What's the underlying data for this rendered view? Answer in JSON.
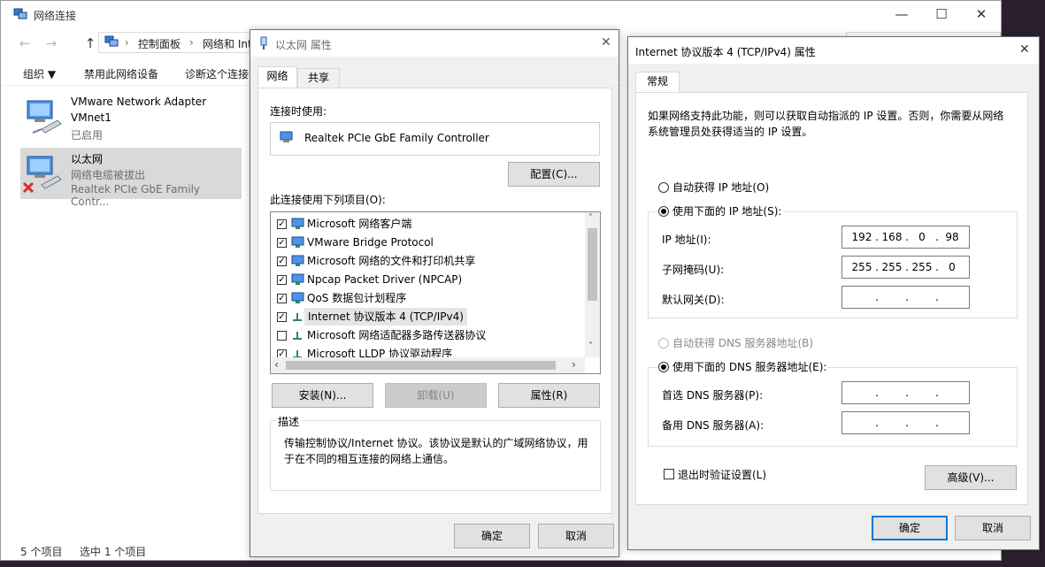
{
  "explorer": {
    "title": "网络连接",
    "nav": {
      "back": "←",
      "forward": "→",
      "up": "↑"
    },
    "breadcrumb": [
      "控制面板",
      "网络和 Int"
    ],
    "commands": [
      "组织 ▼",
      "禁用此网络设备",
      "诊断这个连接"
    ],
    "items": [
      {
        "name": "VMware Network Adapter",
        "line2": "VMnet1",
        "line3": "已启用"
      },
      {
        "name": "以太网",
        "line2": "网络电缆被拔出",
        "line3": "Realtek PCIe GbE Family Contr..."
      }
    ],
    "status": {
      "count": "5 个项目",
      "selected": "选中 1 个项目"
    },
    "window_buttons": {
      "minimize": "—",
      "maximize": "☐",
      "close": "✕"
    }
  },
  "eth_dialog": {
    "title": "以太网 属性",
    "close": "✕",
    "tabs": [
      "网络",
      "共享"
    ],
    "connect_using_label": "连接时使用:",
    "adapter": "Realtek PCIe GbE Family Controller",
    "configure_button": "配置(C)...",
    "items_label": "此连接使用下列项目(O):",
    "items": [
      {
        "label": "Microsoft 网络客户端",
        "checked": true
      },
      {
        "label": "VMware Bridge Protocol",
        "checked": true
      },
      {
        "label": "Microsoft 网络的文件和打印机共享",
        "checked": true
      },
      {
        "label": "Npcap Packet Driver (NPCAP)",
        "checked": true
      },
      {
        "label": "QoS 数据包计划程序",
        "checked": true
      },
      {
        "label": "Internet 协议版本 4 (TCP/IPv4)",
        "checked": true
      },
      {
        "label": "Microsoft 网络适配器多路传送器协议",
        "checked": false
      },
      {
        "label": "Microsoft LLDP 协议驱动程序",
        "checked": true
      }
    ],
    "install_button": "安装(N)...",
    "uninstall_button": "卸载(U)",
    "properties_button": "属性(R)",
    "description_label": "描述",
    "description_text": "传输控制协议/Internet 协议。该协议是默认的广域网络协议，用于在不同的相互连接的网络上通信。",
    "ok_button": "确定",
    "cancel_button": "取消"
  },
  "ipv4_dialog": {
    "title": "Internet 协议版本 4 (TCP/IPv4) 属性",
    "close": "✕",
    "tab": "常规",
    "intro": "如果网络支持此功能，则可以获取自动指派的 IP 设置。否则，你需要从网络系统管理员处获得适当的 IP 设置。",
    "auto_ip": "自动获得 IP 地址(O)",
    "use_ip": "使用下面的 IP 地址(S):",
    "ip_label": "IP 地址(I):",
    "ip_value": [
      "192",
      "168",
      "0",
      "98"
    ],
    "mask_label": "子网掩码(U):",
    "mask_value": [
      "255",
      "255",
      "255",
      "0"
    ],
    "gateway_label": "默认网关(D):",
    "auto_dns": "自动获得 DNS 服务器地址(B)",
    "use_dns": "使用下面的 DNS 服务器地址(E):",
    "dns1_label": "首选 DNS 服务器(P):",
    "dns2_label": "备用 DNS 服务器(A):",
    "validate_label": "退出时验证设置(L)",
    "advanced_button": "高级(V)...",
    "ok_button": "确定",
    "cancel_button": "取消"
  },
  "colors": {
    "accent": "#0078d7",
    "selection": "#d9d9d9",
    "dialog_bg": "#f0f0f0"
  }
}
